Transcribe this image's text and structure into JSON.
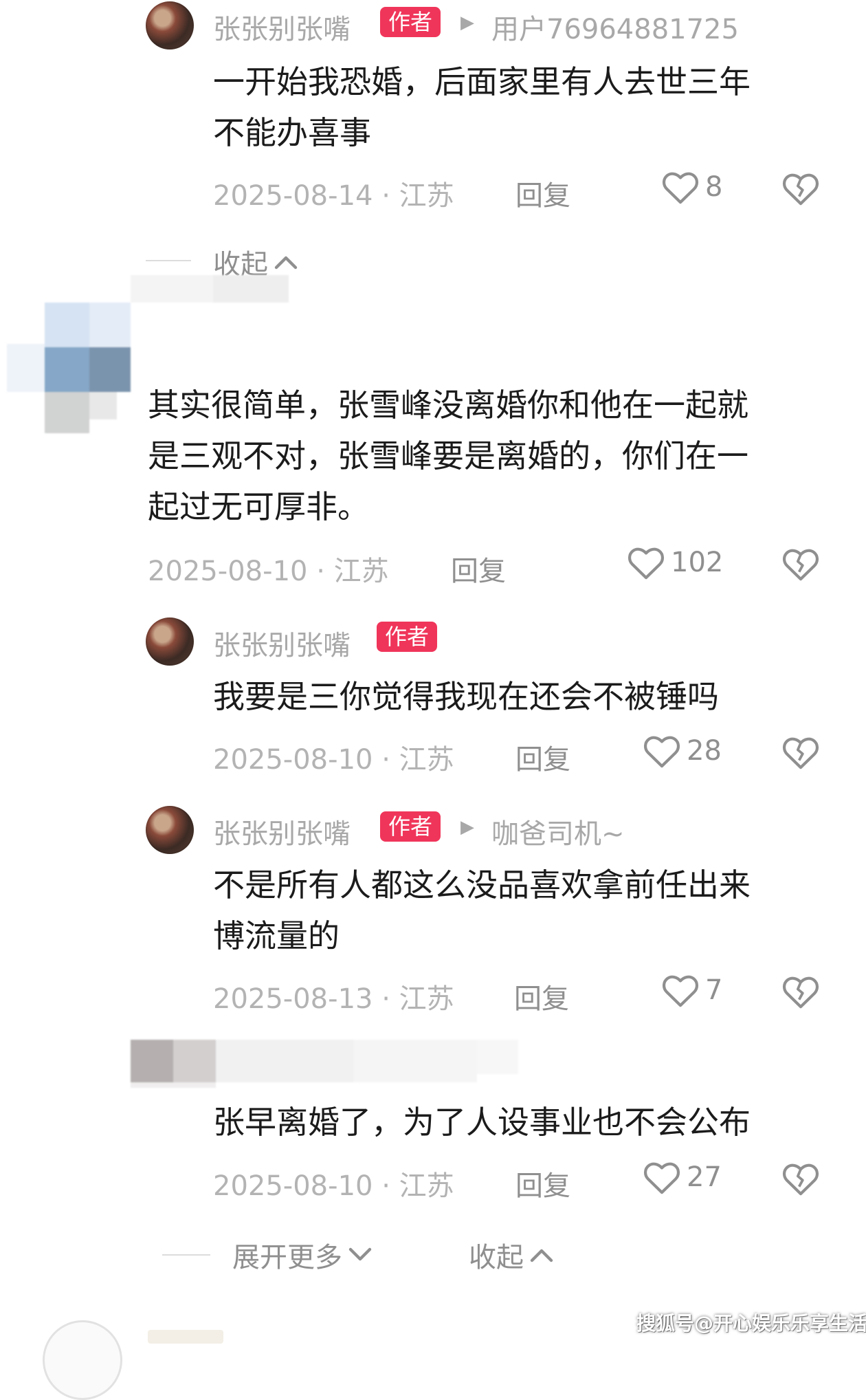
{
  "comments": [
    {
      "author": "张张别张嘴",
      "badge": "作者",
      "reply_to": "用户76964881725",
      "text_lines": [
        "一开始我恐婚，后面家里有人去世三年",
        "不能办喜事"
      ],
      "date": "2025-08-14",
      "location": "江苏",
      "reply_label": "回复",
      "likes": "8"
    },
    {
      "text_lines": [
        "其实很简单，张雪峰没离婚你和他在一起就",
        "是三观不对，张雪峰要是离婚的，你们在一",
        "起过无可厚非。"
      ],
      "date": "2025-08-10",
      "location": "江苏",
      "reply_label": "回复",
      "likes": "102"
    },
    {
      "author": "张张别张嘴",
      "badge": "作者",
      "text_lines": [
        "我要是三你觉得我现在还会不被锤吗"
      ],
      "date": "2025-08-10",
      "location": "江苏",
      "reply_label": "回复",
      "likes": "28"
    },
    {
      "author": "张张别张嘴",
      "badge": "作者",
      "reply_to": "咖爸司机~",
      "text_lines": [
        "不是所有人都这么没品喜欢拿前任出来",
        "博流量的"
      ],
      "date": "2025-08-13",
      "location": "江苏",
      "reply_label": "回复",
      "likes": "7"
    },
    {
      "text_lines": [
        "张早离婚了，为了人设事业也不会公布"
      ],
      "date": "2025-08-10",
      "location": "江苏",
      "reply_label": "回复",
      "likes": "27"
    }
  ],
  "fold_label": "收起",
  "expand_more_label": "展开更多",
  "separator_dot": "·",
  "watermark": "搜狐号@开心娱乐乐享生活",
  "colors": {
    "badge": "#f0355a",
    "meta": "#b3b3b3",
    "text": "#1b1b1b"
  },
  "icons": {
    "like": "heart-outline-icon",
    "dislike": "broken-heart-icon",
    "fold": "chevron-up-icon",
    "expand": "chevron-down-icon",
    "reply_arrow": "play-triangle-icon"
  }
}
